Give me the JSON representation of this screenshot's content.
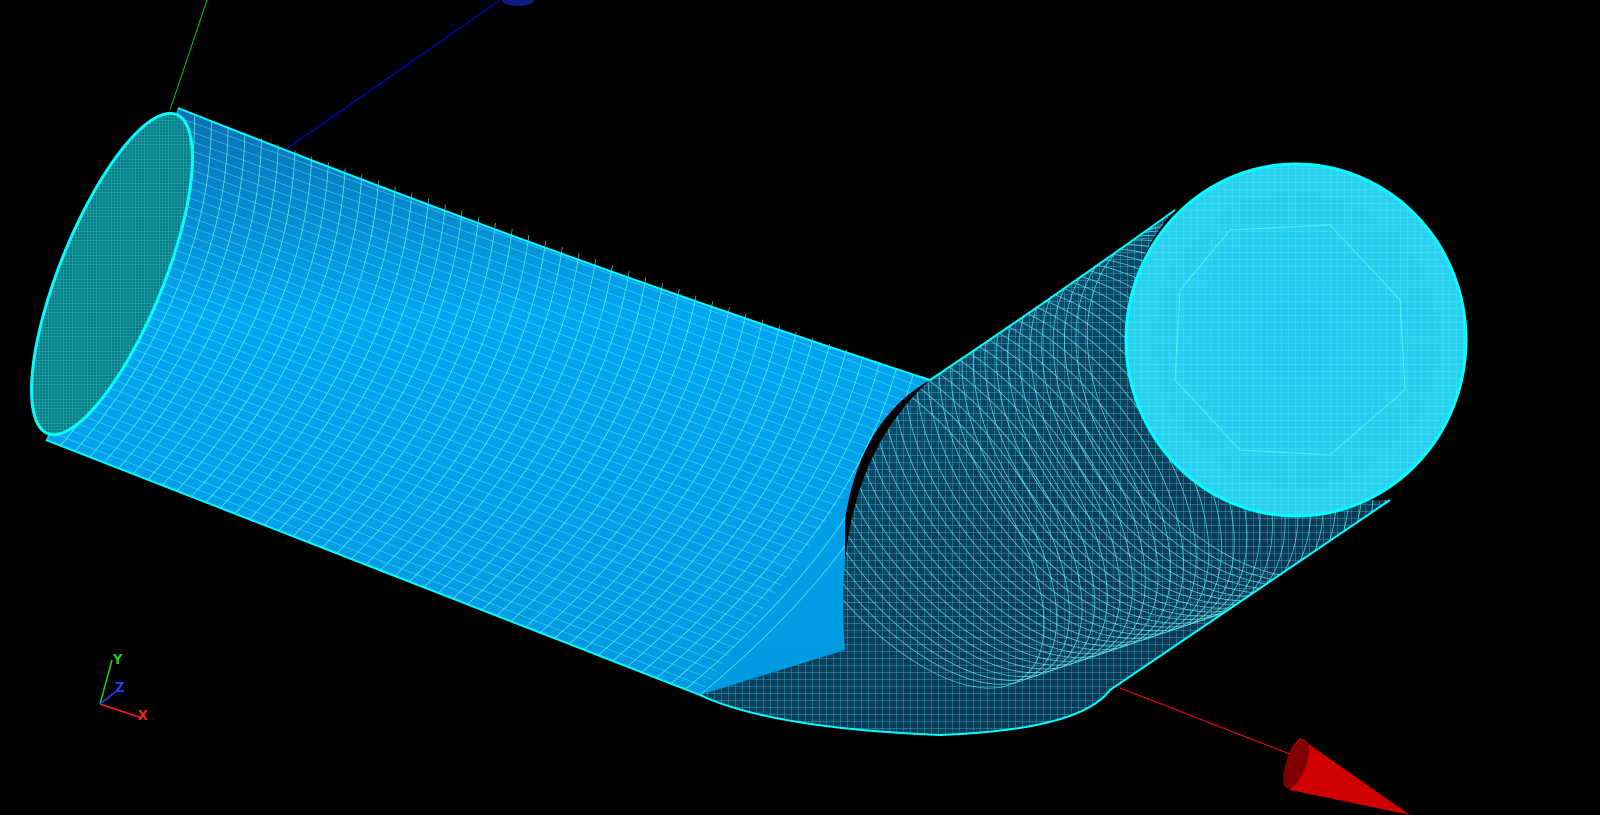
{
  "viewer": {
    "background_color": "#000000",
    "mesh_color": "#00ffff",
    "surface_color": "#0099e6",
    "surface_shadow_color": "#0b3a52"
  },
  "scene_axes": {
    "x_color": "#ff0000",
    "y_color": "#00cc00",
    "z_color": "#0000ff"
  },
  "triad": {
    "x_label": "X",
    "y_label": "Y",
    "z_label": "Z",
    "x_color": "#ff2020",
    "y_color": "#20cc20",
    "z_color": "#2040ff"
  },
  "model": {
    "shape": "bent-pipe-mesh",
    "display_mode": "surface-with-edges"
  }
}
